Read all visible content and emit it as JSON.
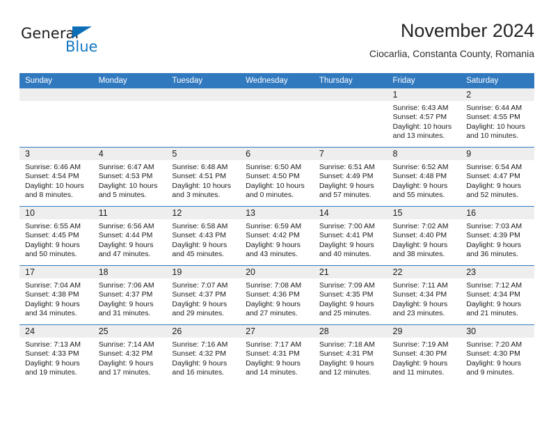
{
  "brand": {
    "word_one": "General",
    "word_two": "Blue",
    "logo_blue": "#0d6eb8",
    "text_blue": "#1277c4"
  },
  "header": {
    "title": "November 2024",
    "subtitle": "Ciocarlia, Constanta County, Romania",
    "header_bg": "#3179bf",
    "daynum_bg": "#eeeeee"
  },
  "weekday_headers": [
    "Sunday",
    "Monday",
    "Tuesday",
    "Wednesday",
    "Thursday",
    "Friday",
    "Saturday"
  ],
  "labels": {
    "sunrise_prefix": "Sunrise:",
    "sunset_prefix": "Sunset:",
    "daylight_prefix": "Daylight:"
  },
  "weeks": [
    [
      {
        "day": "",
        "sunrise": "",
        "sunset": "",
        "daylight_line1": "",
        "daylight_line2": "",
        "empty": true
      },
      {
        "day": "",
        "sunrise": "",
        "sunset": "",
        "daylight_line1": "",
        "daylight_line2": "",
        "empty": true
      },
      {
        "day": "",
        "sunrise": "",
        "sunset": "",
        "daylight_line1": "",
        "daylight_line2": "",
        "empty": true
      },
      {
        "day": "",
        "sunrise": "",
        "sunset": "",
        "daylight_line1": "",
        "daylight_line2": "",
        "empty": true
      },
      {
        "day": "",
        "sunrise": "",
        "sunset": "",
        "daylight_line1": "",
        "daylight_line2": "",
        "empty": true
      },
      {
        "day": "1",
        "sunrise": "Sunrise: 6:43 AM",
        "sunset": "Sunset: 4:57 PM",
        "daylight_line1": "Daylight: 10 hours",
        "daylight_line2": "and 13 minutes."
      },
      {
        "day": "2",
        "sunrise": "Sunrise: 6:44 AM",
        "sunset": "Sunset: 4:55 PM",
        "daylight_line1": "Daylight: 10 hours",
        "daylight_line2": "and 10 minutes."
      }
    ],
    [
      {
        "day": "3",
        "sunrise": "Sunrise: 6:46 AM",
        "sunset": "Sunset: 4:54 PM",
        "daylight_line1": "Daylight: 10 hours",
        "daylight_line2": "and 8 minutes."
      },
      {
        "day": "4",
        "sunrise": "Sunrise: 6:47 AM",
        "sunset": "Sunset: 4:53 PM",
        "daylight_line1": "Daylight: 10 hours",
        "daylight_line2": "and 5 minutes."
      },
      {
        "day": "5",
        "sunrise": "Sunrise: 6:48 AM",
        "sunset": "Sunset: 4:51 PM",
        "daylight_line1": "Daylight: 10 hours",
        "daylight_line2": "and 3 minutes."
      },
      {
        "day": "6",
        "sunrise": "Sunrise: 6:50 AM",
        "sunset": "Sunset: 4:50 PM",
        "daylight_line1": "Daylight: 10 hours",
        "daylight_line2": "and 0 minutes."
      },
      {
        "day": "7",
        "sunrise": "Sunrise: 6:51 AM",
        "sunset": "Sunset: 4:49 PM",
        "daylight_line1": "Daylight: 9 hours",
        "daylight_line2": "and 57 minutes."
      },
      {
        "day": "8",
        "sunrise": "Sunrise: 6:52 AM",
        "sunset": "Sunset: 4:48 PM",
        "daylight_line1": "Daylight: 9 hours",
        "daylight_line2": "and 55 minutes."
      },
      {
        "day": "9",
        "sunrise": "Sunrise: 6:54 AM",
        "sunset": "Sunset: 4:47 PM",
        "daylight_line1": "Daylight: 9 hours",
        "daylight_line2": "and 52 minutes."
      }
    ],
    [
      {
        "day": "10",
        "sunrise": "Sunrise: 6:55 AM",
        "sunset": "Sunset: 4:45 PM",
        "daylight_line1": "Daylight: 9 hours",
        "daylight_line2": "and 50 minutes."
      },
      {
        "day": "11",
        "sunrise": "Sunrise: 6:56 AM",
        "sunset": "Sunset: 4:44 PM",
        "daylight_line1": "Daylight: 9 hours",
        "daylight_line2": "and 47 minutes."
      },
      {
        "day": "12",
        "sunrise": "Sunrise: 6:58 AM",
        "sunset": "Sunset: 4:43 PM",
        "daylight_line1": "Daylight: 9 hours",
        "daylight_line2": "and 45 minutes."
      },
      {
        "day": "13",
        "sunrise": "Sunrise: 6:59 AM",
        "sunset": "Sunset: 4:42 PM",
        "daylight_line1": "Daylight: 9 hours",
        "daylight_line2": "and 43 minutes."
      },
      {
        "day": "14",
        "sunrise": "Sunrise: 7:00 AM",
        "sunset": "Sunset: 4:41 PM",
        "daylight_line1": "Daylight: 9 hours",
        "daylight_line2": "and 40 minutes."
      },
      {
        "day": "15",
        "sunrise": "Sunrise: 7:02 AM",
        "sunset": "Sunset: 4:40 PM",
        "daylight_line1": "Daylight: 9 hours",
        "daylight_line2": "and 38 minutes."
      },
      {
        "day": "16",
        "sunrise": "Sunrise: 7:03 AM",
        "sunset": "Sunset: 4:39 PM",
        "daylight_line1": "Daylight: 9 hours",
        "daylight_line2": "and 36 minutes."
      }
    ],
    [
      {
        "day": "17",
        "sunrise": "Sunrise: 7:04 AM",
        "sunset": "Sunset: 4:38 PM",
        "daylight_line1": "Daylight: 9 hours",
        "daylight_line2": "and 34 minutes."
      },
      {
        "day": "18",
        "sunrise": "Sunrise: 7:06 AM",
        "sunset": "Sunset: 4:37 PM",
        "daylight_line1": "Daylight: 9 hours",
        "daylight_line2": "and 31 minutes."
      },
      {
        "day": "19",
        "sunrise": "Sunrise: 7:07 AM",
        "sunset": "Sunset: 4:37 PM",
        "daylight_line1": "Daylight: 9 hours",
        "daylight_line2": "and 29 minutes."
      },
      {
        "day": "20",
        "sunrise": "Sunrise: 7:08 AM",
        "sunset": "Sunset: 4:36 PM",
        "daylight_line1": "Daylight: 9 hours",
        "daylight_line2": "and 27 minutes."
      },
      {
        "day": "21",
        "sunrise": "Sunrise: 7:09 AM",
        "sunset": "Sunset: 4:35 PM",
        "daylight_line1": "Daylight: 9 hours",
        "daylight_line2": "and 25 minutes."
      },
      {
        "day": "22",
        "sunrise": "Sunrise: 7:11 AM",
        "sunset": "Sunset: 4:34 PM",
        "daylight_line1": "Daylight: 9 hours",
        "daylight_line2": "and 23 minutes."
      },
      {
        "day": "23",
        "sunrise": "Sunrise: 7:12 AM",
        "sunset": "Sunset: 4:34 PM",
        "daylight_line1": "Daylight: 9 hours",
        "daylight_line2": "and 21 minutes."
      }
    ],
    [
      {
        "day": "24",
        "sunrise": "Sunrise: 7:13 AM",
        "sunset": "Sunset: 4:33 PM",
        "daylight_line1": "Daylight: 9 hours",
        "daylight_line2": "and 19 minutes."
      },
      {
        "day": "25",
        "sunrise": "Sunrise: 7:14 AM",
        "sunset": "Sunset: 4:32 PM",
        "daylight_line1": "Daylight: 9 hours",
        "daylight_line2": "and 17 minutes."
      },
      {
        "day": "26",
        "sunrise": "Sunrise: 7:16 AM",
        "sunset": "Sunset: 4:32 PM",
        "daylight_line1": "Daylight: 9 hours",
        "daylight_line2": "and 16 minutes."
      },
      {
        "day": "27",
        "sunrise": "Sunrise: 7:17 AM",
        "sunset": "Sunset: 4:31 PM",
        "daylight_line1": "Daylight: 9 hours",
        "daylight_line2": "and 14 minutes."
      },
      {
        "day": "28",
        "sunrise": "Sunrise: 7:18 AM",
        "sunset": "Sunset: 4:31 PM",
        "daylight_line1": "Daylight: 9 hours",
        "daylight_line2": "and 12 minutes."
      },
      {
        "day": "29",
        "sunrise": "Sunrise: 7:19 AM",
        "sunset": "Sunset: 4:30 PM",
        "daylight_line1": "Daylight: 9 hours",
        "daylight_line2": "and 11 minutes."
      },
      {
        "day": "30",
        "sunrise": "Sunrise: 7:20 AM",
        "sunset": "Sunset: 4:30 PM",
        "daylight_line1": "Daylight: 9 hours",
        "daylight_line2": "and 9 minutes."
      }
    ]
  ]
}
